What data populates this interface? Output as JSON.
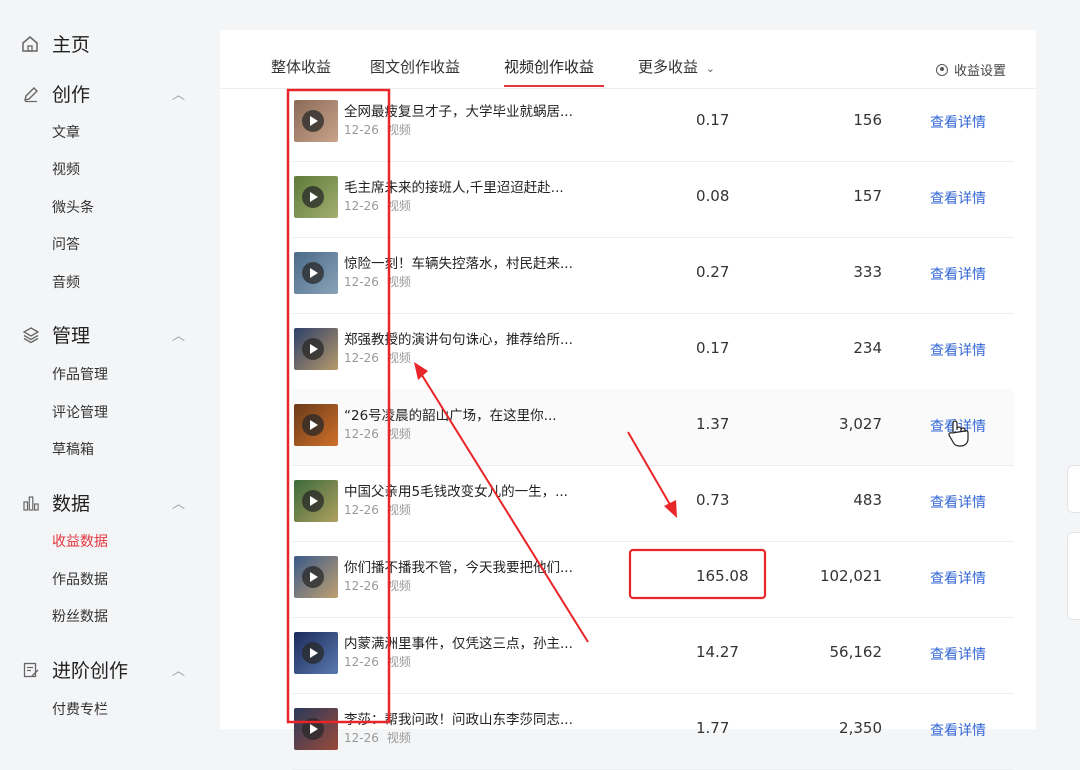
{
  "sidebar": {
    "home": "主页",
    "create": {
      "label": "创作",
      "items": [
        "文章",
        "视频",
        "微头条",
        "问答",
        "音频"
      ]
    },
    "manage": {
      "label": "管理",
      "items": [
        "作品管理",
        "评论管理",
        "草稿箱"
      ]
    },
    "data": {
      "label": "数据",
      "items": [
        "收益数据",
        "作品数据",
        "粉丝数据"
      ]
    },
    "advanced": {
      "label": "进阶创作",
      "items": [
        "付费专栏"
      ]
    }
  },
  "tabs": [
    "整体收益",
    "图文创作收益",
    "视频创作收益",
    "更多收益"
  ],
  "active_tab": "视频创作收益",
  "settings_label": "收益设置",
  "rows": [
    {
      "title": "全网最疲复旦才子，大学毕业就蜗居...",
      "date": "12-26",
      "type": "视频",
      "income": "0.17",
      "plays": "156",
      "action": "查看详情"
    },
    {
      "title": "毛主席未来的接班人,千里迢迢赶赴...",
      "date": "12-26",
      "type": "视频",
      "income": "0.08",
      "plays": "157",
      "action": "查看详情"
    },
    {
      "title": "惊险一刻！车辆失控落水，村民赶来...",
      "date": "12-26",
      "type": "视频",
      "income": "0.27",
      "plays": "333",
      "action": "查看详情"
    },
    {
      "title": "郑强教授的演讲句句诛心，推荐给所...",
      "date": "12-26",
      "type": "视频",
      "income": "0.17",
      "plays": "234",
      "action": "查看详情"
    },
    {
      "title": "“26号凌晨的韶山广场，在这里你...",
      "date": "12-26",
      "type": "视频",
      "income": "1.37",
      "plays": "3,027",
      "action": "查看详情"
    },
    {
      "title": "中国父亲用5毛钱改变女儿的一生，...",
      "date": "12-26",
      "type": "视频",
      "income": "0.73",
      "plays": "483",
      "action": "查看详情"
    },
    {
      "title": "你们播不播我不管，今天我要把他们...",
      "date": "12-26",
      "type": "视频",
      "income": "165.08",
      "plays": "102,021",
      "action": "查看详情"
    },
    {
      "title": "内蒙满洲里事件，仅凭这三点，孙主...",
      "date": "12-26",
      "type": "视频",
      "income": "14.27",
      "plays": "56,162",
      "action": "查看详情"
    },
    {
      "title": "李莎：帮我问政！问政山东李莎同志...",
      "date": "12-26",
      "type": "视频",
      "income": "1.77",
      "plays": "2,350",
      "action": "查看详情"
    }
  ],
  "colors": {
    "accent": "#e5363f",
    "link": "#3367d6",
    "annotation": "#e8262a"
  },
  "icons": {
    "home": "home-icon",
    "create": "pencil-icon",
    "manage": "layers-icon",
    "data": "bar-chart-icon",
    "advanced": "edit-doc-icon",
    "settings": "gear-icon",
    "play": "play-icon",
    "cursor": "hand-pointer-icon"
  }
}
